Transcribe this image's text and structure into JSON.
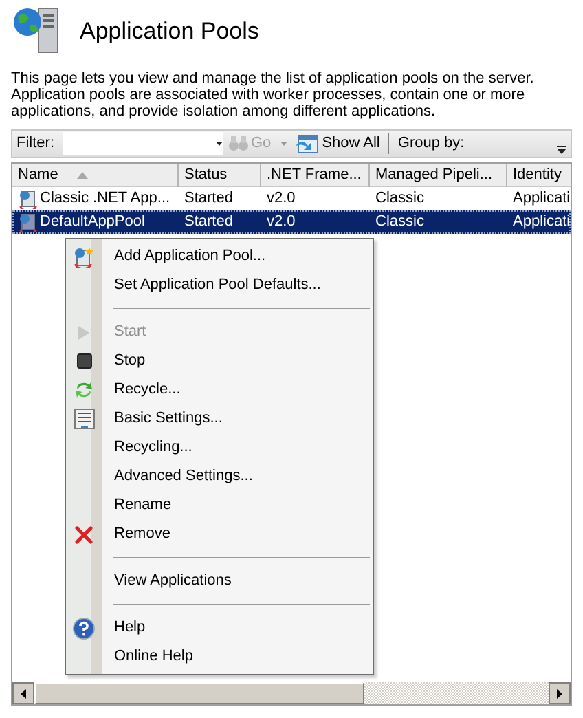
{
  "title": "Application Pools",
  "description": "This page lets you view and manage the list of application pools on the server. Application pools are associated with worker processes, contain one or more applications, and provide isolation among different applications.",
  "toolbar": {
    "filter_label": "Filter:",
    "go": {
      "label": "Go",
      "disabled": true
    },
    "show_all": "Show All",
    "group_by_label": "Group by:"
  },
  "table": {
    "columns": [
      {
        "label": "Name",
        "sorted": true
      },
      {
        "label": "Status"
      },
      {
        "label": ".NET Frame..."
      },
      {
        "label": "Managed Pipeli..."
      },
      {
        "label": "Identity"
      }
    ],
    "rows": [
      {
        "cells": [
          "Classic .NET App...",
          "Started",
          "v2.0",
          "Classic",
          "Applicati"
        ],
        "selected": false
      },
      {
        "cells": [
          "DefaultAppPool",
          "Started",
          "v2.0",
          "Classic",
          "Applicati"
        ],
        "selected": true
      }
    ]
  },
  "context_menu": [
    {
      "kind": "item",
      "label": "Add Application Pool...",
      "disabled": false
    },
    {
      "kind": "item",
      "label": "Set Application Pool Defaults...",
      "disabled": false
    },
    {
      "kind": "separator"
    },
    {
      "kind": "item",
      "label": "Start",
      "disabled": true
    },
    {
      "kind": "item",
      "label": "Stop",
      "disabled": false
    },
    {
      "kind": "item",
      "label": "Recycle...",
      "disabled": false
    },
    {
      "kind": "item",
      "label": "Basic Settings...",
      "disabled": false
    },
    {
      "kind": "item",
      "label": "Recycling...",
      "disabled": false
    },
    {
      "kind": "item",
      "label": "Advanced Settings...",
      "disabled": false
    },
    {
      "kind": "item",
      "label": "Rename",
      "disabled": false
    },
    {
      "kind": "item",
      "label": "Remove",
      "disabled": false
    },
    {
      "kind": "separator"
    },
    {
      "kind": "item",
      "label": "View Applications",
      "disabled": false
    },
    {
      "kind": "separator"
    },
    {
      "kind": "item",
      "label": "Help",
      "disabled": false
    },
    {
      "kind": "item",
      "label": "Online Help",
      "disabled": false
    }
  ]
}
